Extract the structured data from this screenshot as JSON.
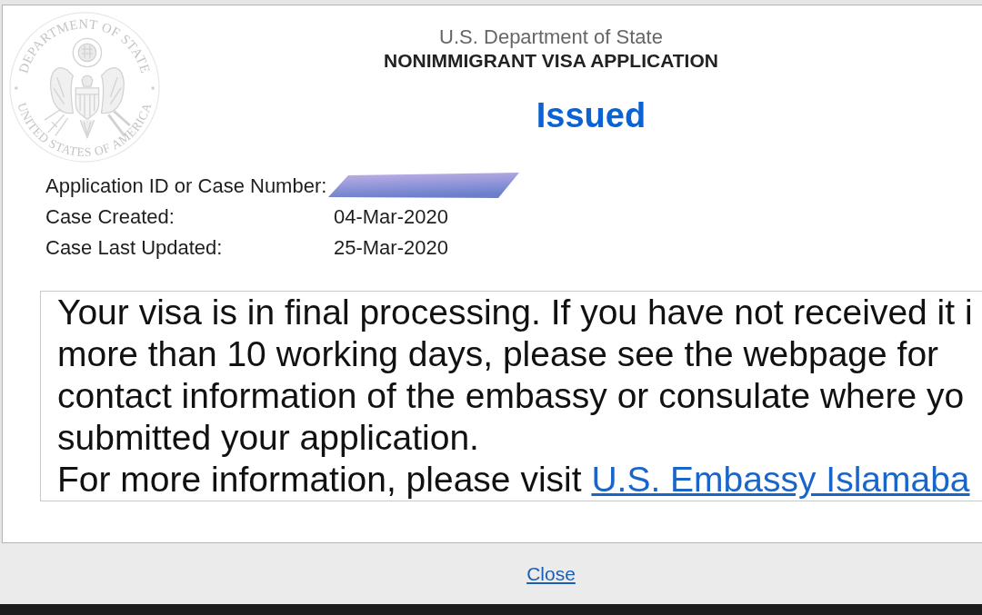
{
  "seal": {
    "top_text": "DEPARTMENT OF STATE",
    "bottom_text": "UNITED STATES OF AMERICA"
  },
  "header": {
    "agency": "U.S. Department of State",
    "title": "NONIMMIGRANT VISA APPLICATION"
  },
  "status": "Issued",
  "info_rows": [
    {
      "label": "Application ID or Case Number:",
      "redacted": true
    },
    {
      "label": "Case Created:",
      "value": "04-Mar-2020",
      "redacted": false
    },
    {
      "label": "Case Last Updated:",
      "value": "25-Mar-2020",
      "redacted": false
    }
  ],
  "message": {
    "lines": [
      "Your visa is in final processing. If you have not received it i",
      "more than 10 working days, please see the webpage for",
      "contact information of the embassy or consulate where yo",
      "submitted your application."
    ],
    "more_info": "For more information, please visit",
    "link": "U.S. Embassy Islamaba"
  },
  "footer": {
    "close_link": "Close"
  }
}
